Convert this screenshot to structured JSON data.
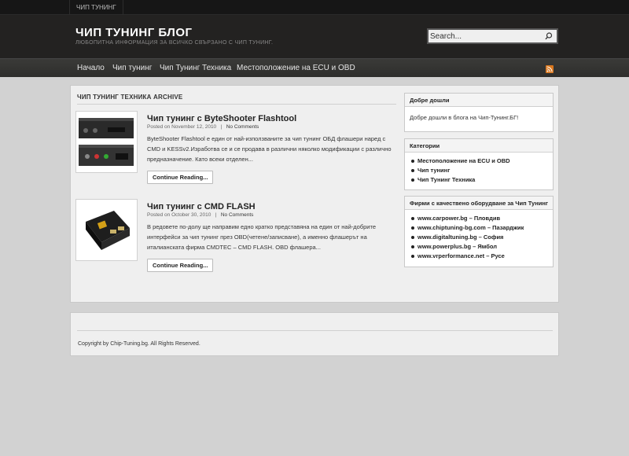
{
  "topbar": {
    "link": "ЧИП ТУНИНГ"
  },
  "header": {
    "title": "ЧИП ТУНИНГ БЛОГ",
    "description": "ЛЮБОПИТНА ИНФОРМАЦИЯ ЗА ВСИЧКО СВЪРЗАНО С ЧИП ТУНИНГ.",
    "search_value": "Search..."
  },
  "nav": {
    "items": [
      "Начало",
      "Чип тунинг",
      "Чип Тунинг Техника",
      "Местоположение на ECU и OBD"
    ],
    "rss": "rss-icon"
  },
  "archive": {
    "title": "ЧИП ТУНИНГ ТЕХНИКА ARCHIVE"
  },
  "posts": [
    {
      "title": "Чип тунинг с ByteShooter Flashtool",
      "meta_prefix": "Posted on November 12, 2010",
      "comments": "No Comments",
      "excerpt": "ByteShooter Flashtool е един от най-използваните за чип тунинг ОБД флашери наред с CMD и KESSv2.Изработва се и се продава в различни няколко модификации с различно предназначение. Като всеки отделен...",
      "button": "Continue Reading..."
    },
    {
      "title": "Чип тунинг с CMD FLASH",
      "meta_prefix": "Posted on October 30, 2010",
      "comments": "No Comments",
      "excerpt": "В редовете по-долу ще направим едно кратко представяна на един от най-добрите интерфейси за чип тунинг през OBD(четене/записване), а именно флашерът на италианската фирма CMDTEC – CMD FLASH. OBD флашера...",
      "button": "Continue Reading..."
    }
  ],
  "sidebar": {
    "welcome": {
      "title": "Добре дошли",
      "text": "Добре дошли в блога на Чип-Тунинг.БГ!"
    },
    "categories": {
      "title": "Категории",
      "items": [
        "Местоположение на ECU и OBD",
        "Чип тунинг",
        "Чип Тунинг Техника"
      ]
    },
    "companies": {
      "title": "Фирми с качествено оборудване за Чип Тунинг",
      "items": [
        "www.carpower.bg – Пловдив",
        "www.chiptuning-bg.com – Пазарджик",
        "www.digitaltuning.bg – София",
        "www.powerplus.bg – Ямбол",
        "www.vrperformance.net – Русе"
      ]
    }
  },
  "footer": {
    "copyright": "Copyright by Chip-Tuning.bg. All Rights Reserved."
  }
}
